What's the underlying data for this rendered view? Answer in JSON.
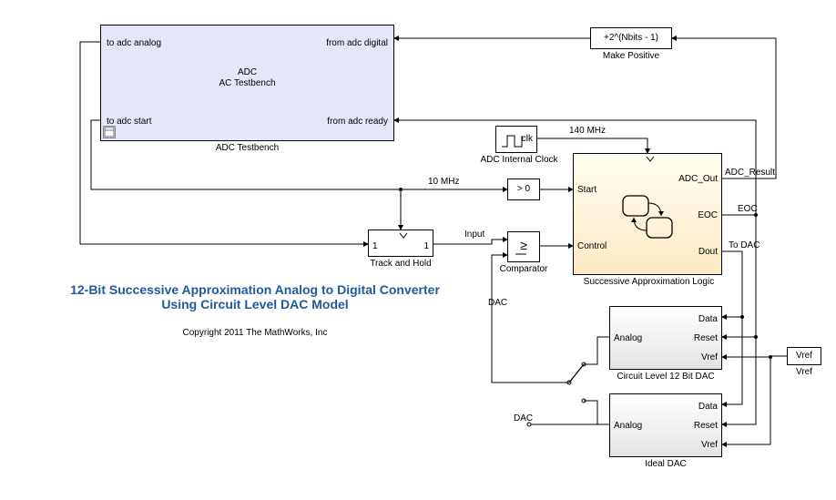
{
  "title_line1": "12-Bit Successive Approximation Analog to Digital Converter",
  "title_line2": "Using Circuit Level DAC Model",
  "copyright": "Copyright 2011 The MathWorks, Inc",
  "adc_testbench": {
    "label": "ADC Testbench",
    "center_line1": "ADC",
    "center_line2": "AC Testbench",
    "port_tl": "to adc analog",
    "port_bl": "to adc start",
    "port_tr": "from adc digital",
    "port_br": "from adc ready"
  },
  "make_positive": {
    "label": "Make Positive",
    "text": "+2^(Nbits - 1)"
  },
  "adc_clock": {
    "label": "ADC Internal Clock",
    "port": "clk"
  },
  "track_hold": {
    "label": "Track and Hold",
    "in": "1",
    "out": "1"
  },
  "gt_zero": {
    "text": "> 0"
  },
  "comparator": {
    "label": "Comparator",
    "text": "≥"
  },
  "sar": {
    "label": "Successive Approximation Logic",
    "port_start": "Start",
    "port_control": "Control",
    "port_adc_out": "ADC_Out",
    "port_eoc": "EOC",
    "port_dout": "Dout"
  },
  "circuit_dac": {
    "label": "Circuit Level 12 Bit DAC",
    "port_analog": "Analog",
    "port_data": "Data",
    "port_reset": "Reset",
    "port_vref": "Vref"
  },
  "ideal_dac": {
    "label": "Ideal DAC",
    "port_analog": "Analog",
    "port_data": "Data",
    "port_reset": "Reset",
    "port_vref": "Vref"
  },
  "vref": {
    "text": "Vref",
    "label": "Vref"
  },
  "wire_labels": {
    "ten_mhz": "10 MHz",
    "one_forty_mhz": "140 MHz",
    "input": "Input",
    "dac1": "DAC",
    "dac2": "DAC",
    "adc_result": "ADC_Result",
    "eoc": "EOC",
    "to_dac": "To DAC"
  }
}
